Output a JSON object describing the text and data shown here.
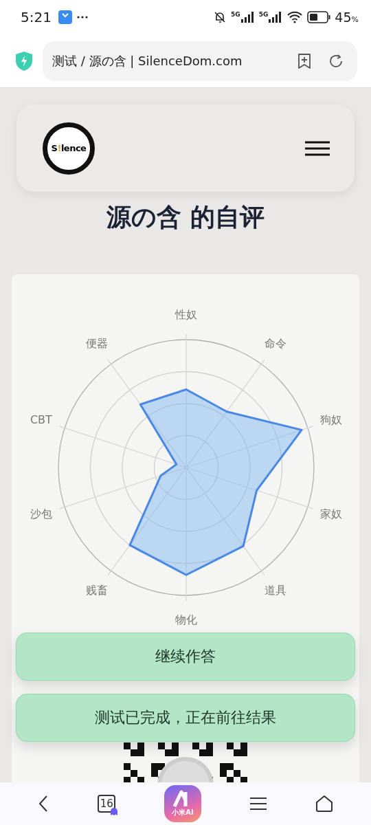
{
  "status_bar": {
    "time": "5:21",
    "network_1": "5G",
    "network_2": "5G",
    "battery": "45",
    "battery_unit": "%"
  },
  "address_bar": {
    "url_text": "测试 / 源の含 | SilenceDom.com"
  },
  "header": {
    "logo": {
      "before": "S",
      "mark": "!",
      "after": "lence"
    }
  },
  "title": "源の含 的自评",
  "radar": {
    "axes": [
      "性奴",
      "命令",
      "狗奴",
      "家奴",
      "道具",
      "物化",
      "贱畜",
      "沙包",
      "CBT",
      "便器"
    ]
  },
  "toasts": [
    "继续作答",
    "测试已完成，正在前往结果"
  ],
  "bottom_nav": {
    "tabs_count": "16",
    "ai_label": "小米AI"
  }
}
